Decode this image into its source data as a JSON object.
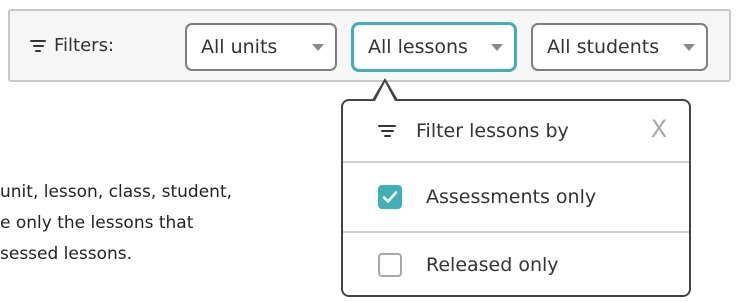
{
  "filter_bar": {
    "label": "Filters:",
    "dropdowns": [
      {
        "label": "All units"
      },
      {
        "label": "All lessons"
      },
      {
        "label": "All students"
      }
    ]
  },
  "background_text": [
    "unit, lesson, class, student,",
    "e only the lessons that",
    "sessed lessons."
  ],
  "popover": {
    "title": "Filter lessons by",
    "close": "X",
    "options": [
      {
        "label": "Assessments only",
        "checked": true
      },
      {
        "label": "Released only",
        "checked": false
      }
    ]
  },
  "colors": {
    "accent": "#3fb0b8",
    "border": "#444444"
  }
}
